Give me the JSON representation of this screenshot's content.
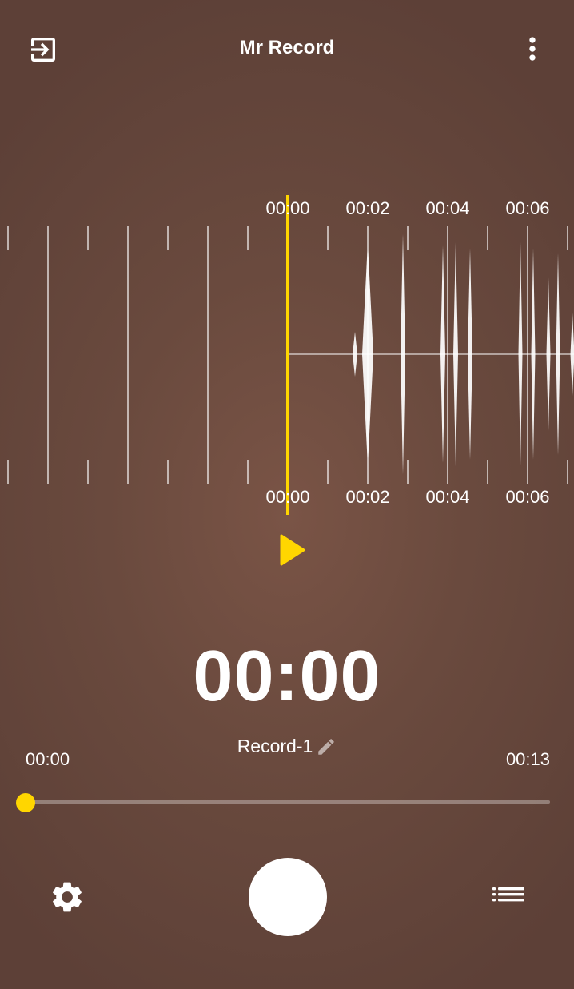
{
  "app": {
    "title": "Mr Record"
  },
  "icons": {
    "exit": "exit-to-app-icon",
    "more": "more-vert-icon",
    "play": "play-icon",
    "edit": "pencil-icon",
    "settings": "gear-icon",
    "record": "record-icon",
    "list": "list-icon"
  },
  "colors": {
    "accent": "#ffd600",
    "background": "#5d4037",
    "text": "#ffffff"
  },
  "waveform": {
    "top_labels": [
      "00:00",
      "00:02",
      "00:04",
      "00:06"
    ],
    "bottom_labels": [
      "00:00",
      "00:02",
      "00:04",
      "00:06"
    ]
  },
  "player": {
    "timer": "00:00",
    "record_name": "Record-1",
    "current_time": "00:00",
    "total_time": "00:13",
    "progress": 0
  }
}
